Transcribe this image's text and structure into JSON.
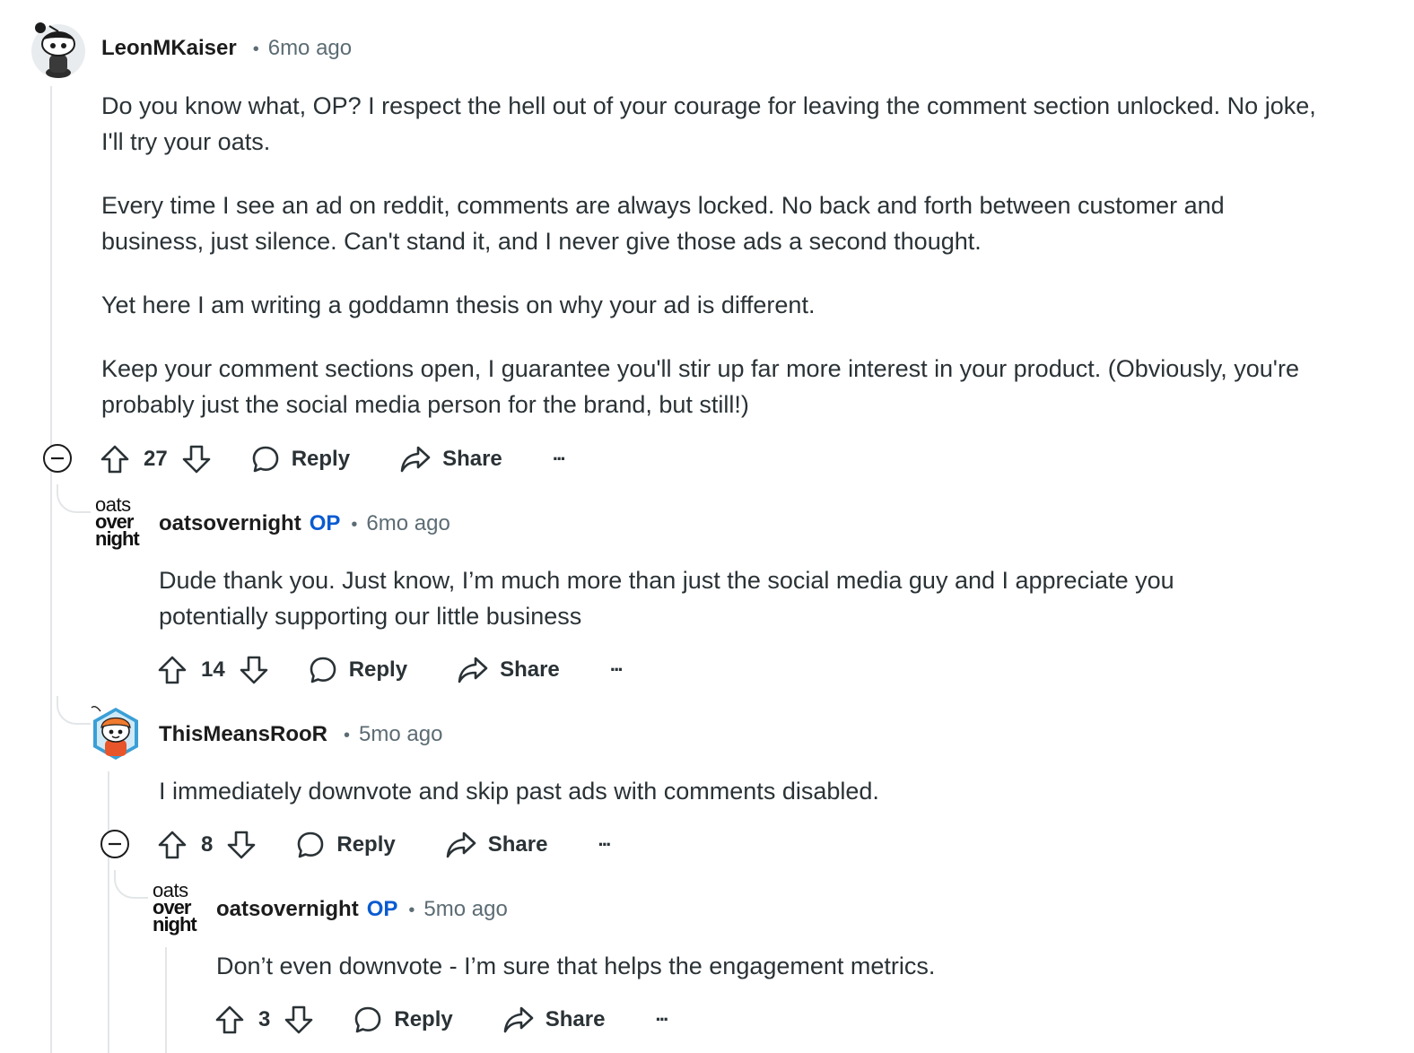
{
  "comments": [
    {
      "username": "LeonMKaiser",
      "op_badge": "",
      "separator": "•",
      "timestamp": "6mo ago",
      "avatar": "snoo-avatar-dark",
      "paragraphs": [
        "Do you know what, OP? I respect the hell out of your courage for leaving the comment section unlocked. No joke, I'll try your oats.",
        "Every time I see an ad on reddit, comments are always locked. No back and forth between customer and business, just silence. Can't stand it, and I never give those ads a second thought.",
        "Yet here I am writing a goddamn thesis on why your ad is different.",
        "Keep your comment sections open, I guarantee you'll stir up far more interest in your product. (Obviously, you're probably just the social media person for the brand, but still!)"
      ],
      "votes": "27",
      "reply_label": "Reply",
      "share_label": "Share",
      "more_label": "···"
    },
    {
      "username": "oatsovernight",
      "op_badge": "OP",
      "separator": "•",
      "timestamp": "6mo ago",
      "avatar_text": [
        "oats",
        "over",
        "night"
      ],
      "paragraphs": [
        "Dude thank you. Just know, I’m much more than just the social media guy and I appreciate you potentially supporting our little business"
      ],
      "votes": "14",
      "reply_label": "Reply",
      "share_label": "Share",
      "more_label": "···"
    },
    {
      "username": "ThisMeansRooR",
      "op_badge": "",
      "separator": "•",
      "timestamp": "5mo ago",
      "avatar": "snoo-avatar-orange-cap",
      "paragraphs": [
        "I immediately downvote and skip past ads with comments disabled."
      ],
      "votes": "8",
      "reply_label": "Reply",
      "share_label": "Share",
      "more_label": "···"
    },
    {
      "username": "oatsovernight",
      "op_badge": "OP",
      "separator": "•",
      "timestamp": "5mo ago",
      "avatar_text": [
        "oats",
        "over",
        "night"
      ],
      "paragraphs": [
        "Don’t even downvote - I’m sure that helps the engagement metrics."
      ],
      "votes": "3",
      "reply_label": "Reply",
      "share_label": "Share",
      "more_label": "···"
    }
  ],
  "colors": {
    "op_badge": "#0a5bd1",
    "thread_line": "#e3e6e8",
    "meta_text": "#5c6c74"
  },
  "icons": [
    "collapse-icon",
    "upvote-icon",
    "downvote-icon",
    "reply-icon",
    "share-icon",
    "more-icon"
  ]
}
